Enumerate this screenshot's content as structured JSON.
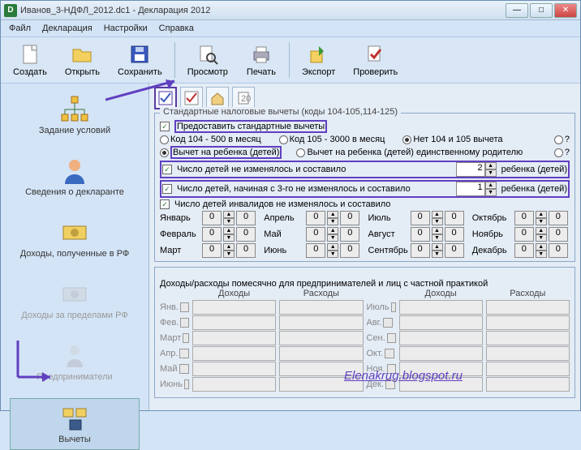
{
  "titlebar": {
    "icon": "D",
    "title": "Иванов_3-НДФЛ_2012.dc1 - Декларация 2012"
  },
  "menu": {
    "file": "Файл",
    "decl": "Декларация",
    "settings": "Настройки",
    "help": "Справка"
  },
  "toolbar": {
    "create": "Создать",
    "open": "Открыть",
    "save": "Сохранить",
    "preview": "Просмотр",
    "print": "Печать",
    "export": "Экспорт",
    "check": "Проверить"
  },
  "nav": {
    "conditions": "Задание условий",
    "declarant": "Сведения о декларанте",
    "income_rf": "Доходы, полученные в РФ",
    "income_abroad": "Доходы за пределами РФ",
    "entrepreneurs": "Предприниматели",
    "deductions": "Вычеты"
  },
  "group1": {
    "legend": "Стандартные налоговые вычеты (коды 104-105,114-125)",
    "provide": "Предоставить стандартные вычеты",
    "code104": "Код 104 - 500 в месяц",
    "code105": "Код 105 - 3000 в месяц",
    "none104105": "Нет 104 и 105 вычета",
    "q": "?",
    "child_deduct": "Вычет на ребенка (детей)",
    "single_parent": "Вычет на ребенка (детей) единственному родителю",
    "children_const": "Число детей не изменялось и составило",
    "children_const_val": "2",
    "children_unit": "ребенка (детей)",
    "children_from3": "Число детей, начиная с 3-го не изменялось и составило",
    "children_from3_val": "1",
    "children_invalid": "Число детей инвалидов не изменялось и составило",
    "months": {
      "jan": "Январь",
      "feb": "Февраль",
      "mar": "Март",
      "apr": "Апрель",
      "may": "Май",
      "jun": "Июнь",
      "jul": "Июль",
      "aug": "Август",
      "sep": "Сентябрь",
      "oct": "Октябрь",
      "nov": "Ноябрь",
      "dec": "Декабрь"
    },
    "zero": "0"
  },
  "group2": {
    "legend": "Доходы/расходы помесячно для предпринимателей и лиц с частной практикой",
    "income": "Доходы",
    "expense": "Расходы",
    "m": {
      "jan": "Янв.",
      "feb": "Фев.",
      "mar": "Март",
      "apr": "Апр.",
      "may": "Май",
      "jun": "Июнь",
      "jul": "Июль",
      "aug": "Авг.",
      "sep": "Сен.",
      "oct": "Окт.",
      "nov": "Ноя.",
      "dec": "Дек."
    }
  },
  "watermark": "Elenakrug.blogspot.ru"
}
